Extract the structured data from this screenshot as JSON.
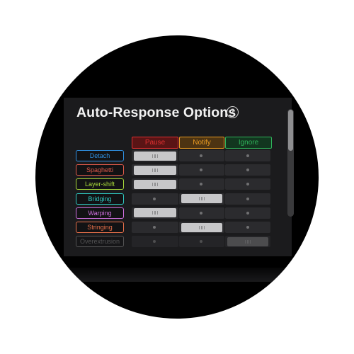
{
  "title": "Auto-Response Options",
  "help_icon": "?",
  "columns": [
    {
      "label": "Pause",
      "color": "#e03030",
      "bg": "#5a1415"
    },
    {
      "label": "Notify",
      "color": "#e89a22",
      "bg": "#4d3412"
    },
    {
      "label": "Ignore",
      "color": "#2fb25a",
      "bg": "#12361f"
    }
  ],
  "rows": [
    {
      "label": "Detach",
      "color": "#2f8fe0",
      "selected": 0
    },
    {
      "label": "Spaghetti",
      "color": "#e05a4a",
      "selected": 0
    },
    {
      "label": "Layer-shift",
      "color": "#a8d83a",
      "selected": 0
    },
    {
      "label": "Bridging",
      "color": "#2fc8c0",
      "selected": 1
    },
    {
      "label": "Warping",
      "color": "#d070e0",
      "selected": 0
    },
    {
      "label": "Stringing",
      "color": "#e8704a",
      "selected": 1
    },
    {
      "label": "Overextrusion",
      "color": "#8a8a8a",
      "selected": 2
    }
  ],
  "scrollbar": {
    "position": 0.0
  }
}
